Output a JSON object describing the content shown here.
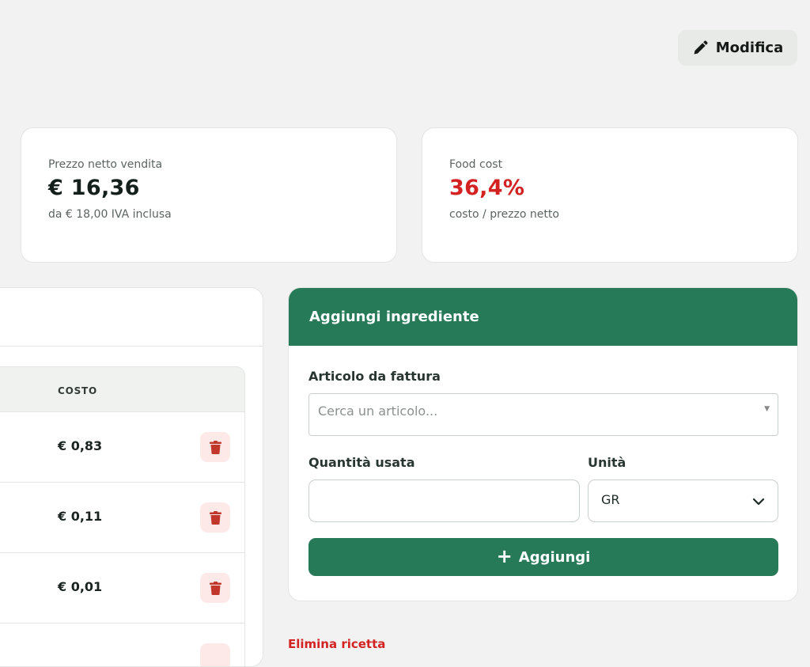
{
  "header": {
    "edit_label": "Modifica"
  },
  "stats": {
    "net_price": {
      "label": "Prezzo netto vendita",
      "value": "€ 16,36",
      "sub": "da € 18,00 IVA inclusa"
    },
    "food_cost": {
      "label": "Food cost",
      "value": "36,4%",
      "sub": "costo / prezzo netto",
      "value_color": "#d42222"
    }
  },
  "ingredients_table": {
    "cost_header": "COSTO",
    "rows": [
      {
        "cost": "€ 0,83"
      },
      {
        "cost": "€ 0,11"
      },
      {
        "cost": "€ 0,01"
      }
    ]
  },
  "add_ingredient": {
    "title": "Aggiungi ingrediente",
    "article_label": "Articolo da fattura",
    "article_placeholder": "Cerca un articolo...",
    "quantity_label": "Quantità usata",
    "quantity_value": "",
    "unit_label": "Unità",
    "unit_value": "GR",
    "add_button_label": "Aggiungi"
  },
  "delete_recipe_label": "Elimina ricetta",
  "colors": {
    "primary": "#277a58",
    "danger": "#d42222",
    "trash_bg": "#fde9e8"
  },
  "icons": {
    "edit": "pencil-icon",
    "trash": "trash-icon",
    "chevron": "chevron-down-icon",
    "plus": "plus-icon"
  }
}
